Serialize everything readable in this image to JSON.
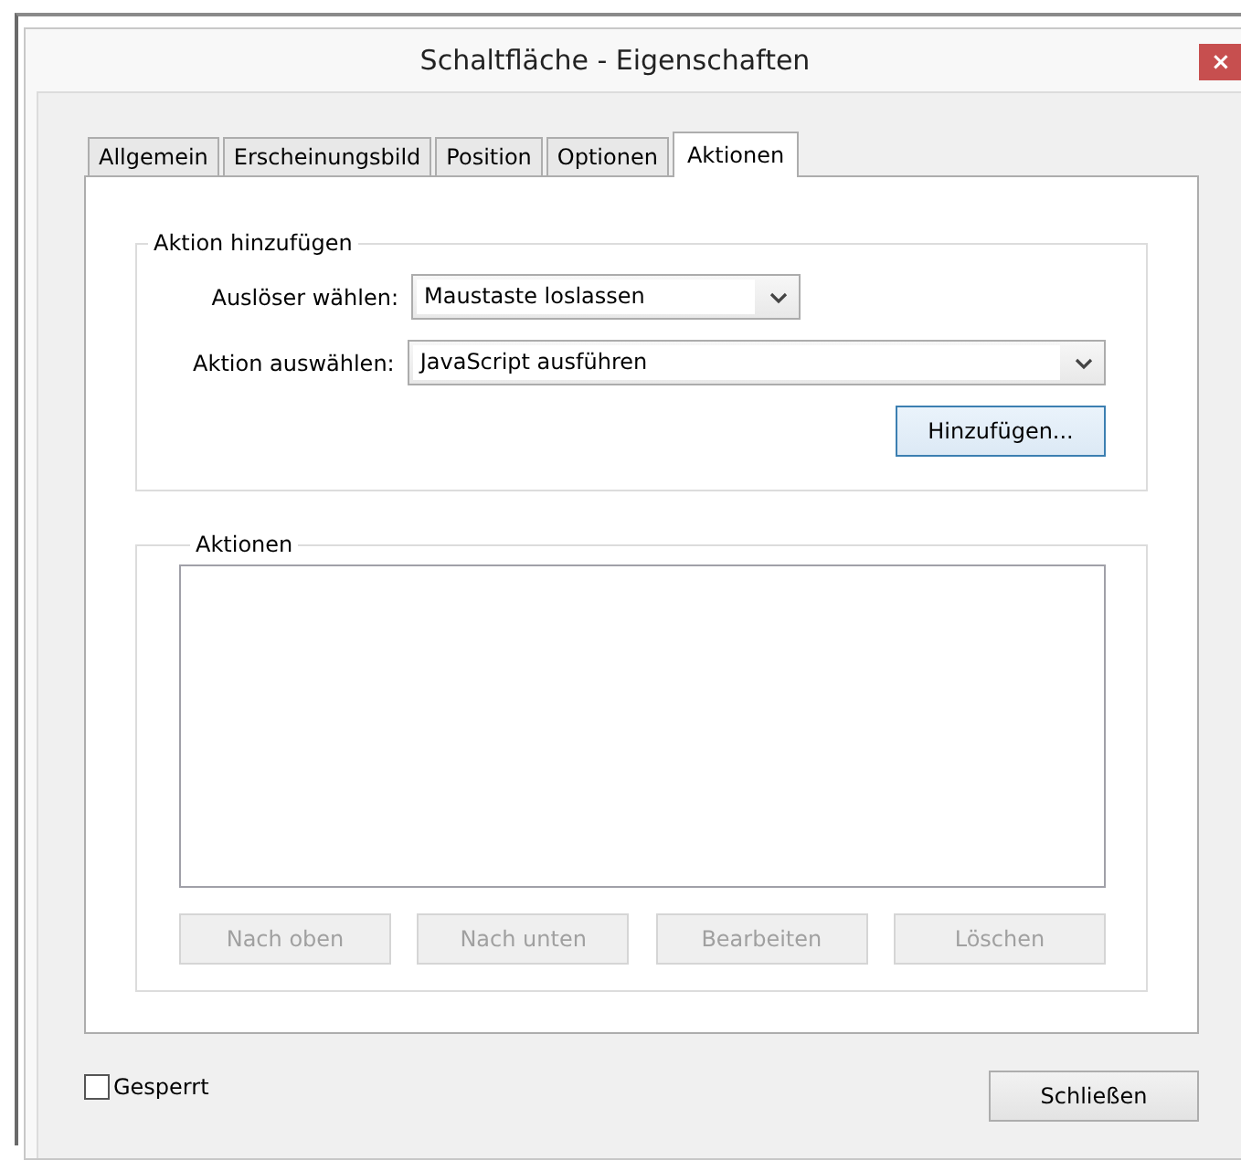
{
  "window": {
    "title": "Schaltfläche - Eigenschaften",
    "close": "×"
  },
  "tabs": [
    {
      "label": "Allgemein",
      "selected": false
    },
    {
      "label": "Erscheinungsbild",
      "selected": false
    },
    {
      "label": "Position",
      "selected": false
    },
    {
      "label": "Optionen",
      "selected": false
    },
    {
      "label": "Aktionen",
      "selected": true
    }
  ],
  "add_action": {
    "title": "Aktion hinzufügen",
    "fields": [
      {
        "label": "Auslöser wählen:",
        "value": "Maustaste loslassen",
        "kind": "short"
      },
      {
        "label": "Aktion auswählen:",
        "value": "JavaScript ausführen",
        "kind": "wide"
      }
    ],
    "button": {
      "label": "Hinzufügen...",
      "focused": true
    }
  },
  "actions": {
    "title": "Aktionen",
    "buttons": [
      {
        "label": "Nach oben",
        "disabled": true
      },
      {
        "label": "Nach unten",
        "disabled": true
      },
      {
        "label": "Bearbeiten",
        "disabled": true
      },
      {
        "label": "Löschen",
        "disabled": true
      }
    ]
  },
  "locked": {
    "label": "Gesperrt",
    "checked": false
  },
  "close_button": "Schließen"
}
